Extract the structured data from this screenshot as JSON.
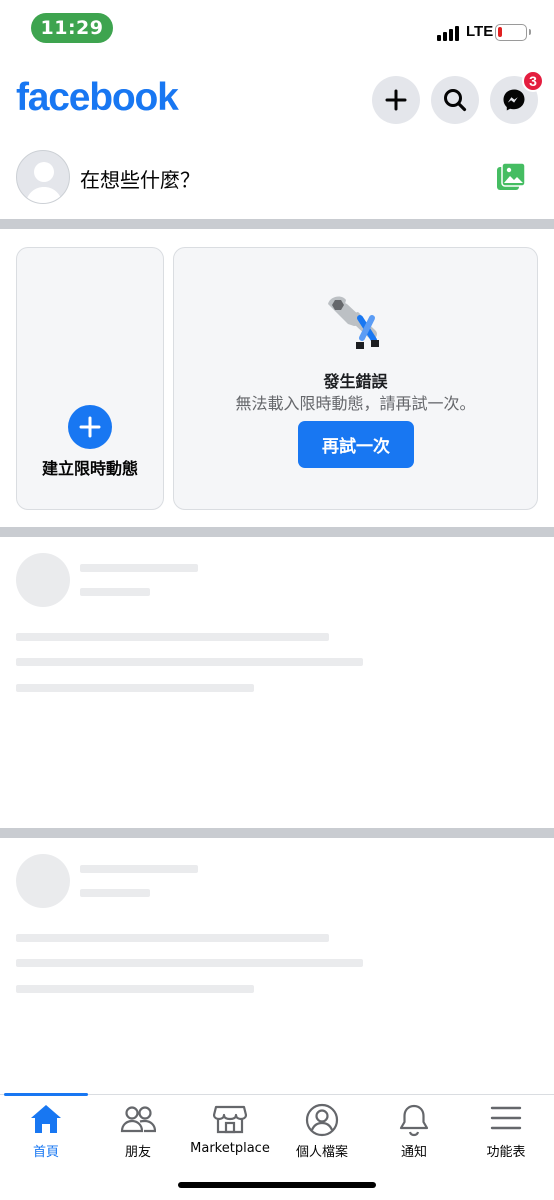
{
  "status_bar": {
    "time": "11:29",
    "network": "LTE"
  },
  "header": {
    "logo": "facebook",
    "messenger_badge": "3"
  },
  "composer": {
    "placeholder": "在想些什麼？"
  },
  "stories": {
    "create_label": "建立限時動態",
    "error_title": "發生錯誤",
    "error_message": "無法載入限時動態，請再試一次。",
    "retry_label": "再試一次"
  },
  "bottom_nav": {
    "items": [
      {
        "label": "首頁",
        "icon": "home-icon",
        "active": true
      },
      {
        "label": "朋友",
        "icon": "friends-icon",
        "active": false
      },
      {
        "label": "Marketplace",
        "icon": "marketplace-icon",
        "active": false
      },
      {
        "label": "個人檔案",
        "icon": "profile-icon",
        "active": false
      },
      {
        "label": "通知",
        "icon": "bell-icon",
        "active": false
      },
      {
        "label": "功能表",
        "icon": "menu-icon",
        "active": false
      }
    ]
  },
  "colors": {
    "brand": "#1877f2",
    "badge": "#e41e3f",
    "skeleton": "#eaebed",
    "divider": "#c9ccd1"
  }
}
